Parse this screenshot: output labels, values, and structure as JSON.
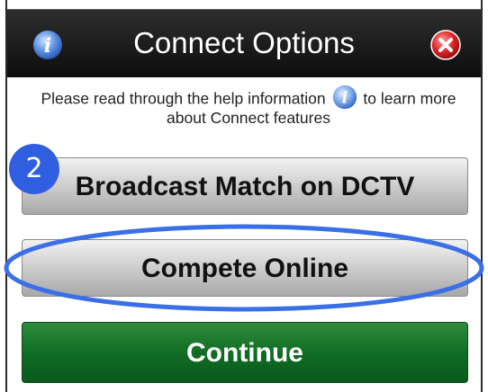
{
  "dialog": {
    "title": "Connect Options",
    "help_text_before": "Please read through the help information",
    "help_text_after": "to learn more about Connect features"
  },
  "buttons": {
    "broadcast_label": "Broadcast Match on DCTV",
    "compete_label": "Compete Online",
    "continue_label": "Continue"
  },
  "annotation": {
    "step_number": "2"
  },
  "colors": {
    "titlebar": "#111111",
    "continue_green": "#0f6b24",
    "annotation_blue": "#2f5fe0"
  },
  "icons": [
    "info-icon",
    "close-icon"
  ]
}
